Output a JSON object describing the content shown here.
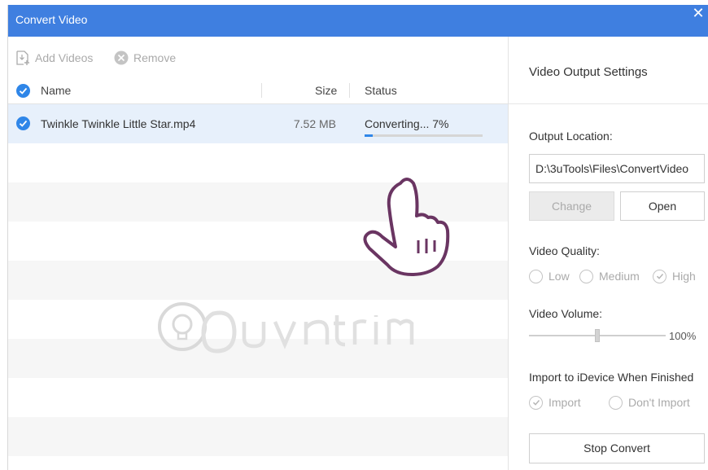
{
  "window": {
    "title": "Convert Video",
    "close_symbol": "✕"
  },
  "toolbar": {
    "add_label": "Add Videos",
    "remove_label": "Remove"
  },
  "table": {
    "columns": {
      "name": "Name",
      "size": "Size",
      "status": "Status"
    },
    "rows": [
      {
        "name": "Twinkle Twinkle Little Star.mp4",
        "size": "7.52 MB",
        "status": "Converting... 7%",
        "progress": 0.07
      }
    ]
  },
  "settings": {
    "title": "Video Output Settings",
    "output_label": "Output Location:",
    "output_path": "D:\\3uTools\\Files\\ConvertVideo",
    "change_label": "Change",
    "open_label": "Open",
    "quality_label": "Video Quality:",
    "quality_options": [
      "Low",
      "Medium",
      "High"
    ],
    "quality_selected": "High",
    "volume_label": "Video Volume:",
    "volume_value": "100%",
    "volume_level": 0.5,
    "import_label": "Import to iDevice When Finished",
    "import_options": [
      "Import",
      "Don't Import"
    ],
    "import_selected": "Import",
    "stop_label": "Stop Convert"
  },
  "colors": {
    "titlebar": "#3f7fe0",
    "accent": "#2f86e8",
    "selected_row": "#e7f0fb"
  }
}
